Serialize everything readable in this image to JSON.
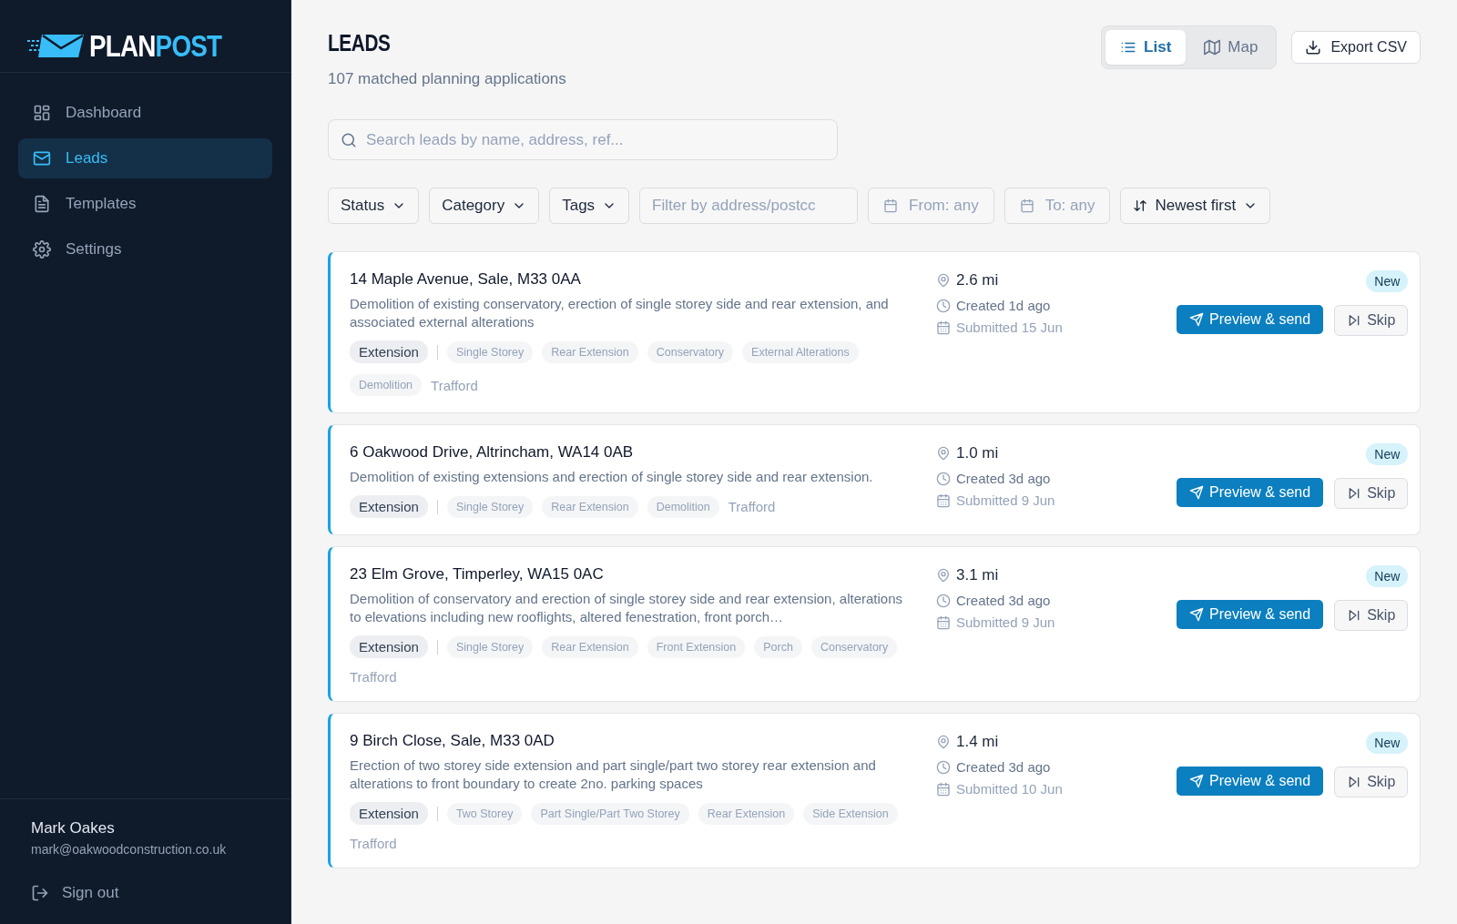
{
  "sidebar": {
    "logo": {
      "parts": [
        {
          "text": "PLAN",
          "accent": false
        },
        {
          "text": "POST",
          "accent": true
        }
      ]
    },
    "nav": [
      {
        "label": "Dashboard",
        "kind": "dashboard",
        "selected": false
      },
      {
        "label": "Leads",
        "kind": "leads",
        "selected": true
      },
      {
        "label": "Templates",
        "kind": "templates",
        "selected": false
      },
      {
        "label": "Settings",
        "kind": "settings",
        "selected": false
      }
    ],
    "user": {
      "name": "Mark Oakes",
      "email": "mark@oakwoodconstruction.co.uk"
    },
    "sign_out": "Sign out"
  },
  "header": {
    "title": "LEADS",
    "subtitle": "107 matched planning applications",
    "view_toggle": [
      {
        "label": "List",
        "kind": "list",
        "selected": true
      },
      {
        "label": "Map",
        "kind": "map",
        "selected": false
      }
    ],
    "export": "Export CSV"
  },
  "search": {
    "placeholder": "Search leads by name, address, ref..."
  },
  "filters": [
    {
      "kind": "dropdown",
      "label": "Status"
    },
    {
      "kind": "dropdown",
      "label": "Category"
    },
    {
      "kind": "dropdown",
      "label": "Tags"
    },
    {
      "kind": "input",
      "placeholder": "Filter by address/postcc"
    },
    {
      "kind": "date",
      "label": "From: any"
    },
    {
      "kind": "date",
      "label": "To: any"
    },
    {
      "kind": "sort",
      "label": "Newest first"
    }
  ],
  "leads": [
    {
      "address": "14 Maple Avenue, Sale, M33 0AA",
      "description": "Demolition of existing conservatory, erection of single storey side and rear extension, and associated external alterations",
      "category": "Extension",
      "tags": [
        "Single Storey",
        "Rear Extension",
        "Conservatory",
        "External Alterations",
        "Demolition"
      ],
      "area": "Trafford",
      "distance": "2.6 mi",
      "created": "Created 1d ago",
      "submitted": "Submitted 15 Jun",
      "status": "New",
      "send": "Preview & send",
      "skip": "Skip"
    },
    {
      "address": "6 Oakwood Drive, Altrincham, WA14 0AB",
      "description": "Demolition of existing extensions and erection of single storey side and rear extension.",
      "category": "Extension",
      "tags": [
        "Single Storey",
        "Rear Extension",
        "Demolition"
      ],
      "area": "Trafford",
      "distance": "1.0 mi",
      "created": "Created 3d ago",
      "submitted": "Submitted 9 Jun",
      "status": "New",
      "send": "Preview & send",
      "skip": "Skip"
    },
    {
      "address": "23 Elm Grove, Timperley, WA15 0AC",
      "description": "Demolition of conservatory and erection of single storey side and rear extension, alterations to elevations including new rooflights, altered fenestration, front porch…",
      "category": "Extension",
      "tags": [
        "Single Storey",
        "Rear Extension",
        "Front Extension",
        "Porch",
        "Conservatory"
      ],
      "area": "Trafford",
      "distance": "3.1 mi",
      "created": "Created 3d ago",
      "submitted": "Submitted 9 Jun",
      "status": "New",
      "send": "Preview & send",
      "skip": "Skip"
    },
    {
      "address": "9 Birch Close, Sale, M33 0AD",
      "description": "Erection of two storey side extension and part single/part two storey rear extension and alterations to front boundary to create 2no. parking spaces",
      "category": "Extension",
      "tags": [
        "Two Storey",
        "Part Single/Part Two Storey",
        "Rear Extension",
        "Side Extension"
      ],
      "area": "Trafford",
      "distance": "1.4 mi",
      "created": "Created 3d ago",
      "submitted": "Submitted 10 Jun",
      "status": "New",
      "send": "Preview & send",
      "skip": "Skip"
    }
  ]
}
